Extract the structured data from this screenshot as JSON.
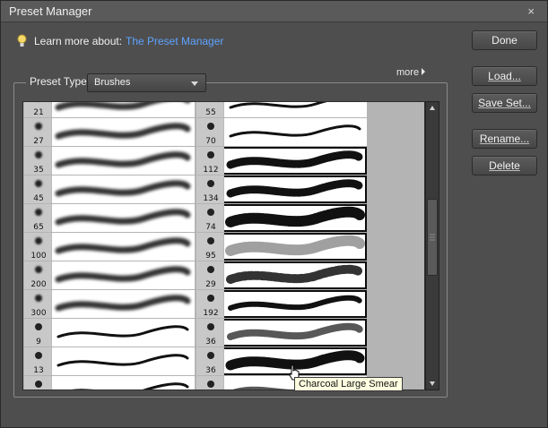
{
  "window": {
    "title": "Preset Manager",
    "close_glyph": "×"
  },
  "learn": {
    "label": "Learn more about:",
    "link": "The Preset Manager",
    "icon": "lightbulb-icon"
  },
  "buttons": {
    "done": "Done",
    "load": "Load...",
    "save_set": "Save Set...",
    "rename": "Rename...",
    "delete": "Delete"
  },
  "more": {
    "label": "more"
  },
  "preset_type": {
    "label": "Preset Type:",
    "value": "Brushes"
  },
  "brushes_left": [
    {
      "size": "21",
      "kind": "soft"
    },
    {
      "size": "27",
      "kind": "soft"
    },
    {
      "size": "35",
      "kind": "soft"
    },
    {
      "size": "45",
      "kind": "soft"
    },
    {
      "size": "65",
      "kind": "soft"
    },
    {
      "size": "100",
      "kind": "soft"
    },
    {
      "size": "200",
      "kind": "soft"
    },
    {
      "size": "300",
      "kind": "soft"
    },
    {
      "size": "9",
      "kind": "hard"
    },
    {
      "size": "13",
      "kind": "hard"
    },
    {
      "size": "",
      "kind": "hard"
    }
  ],
  "brushes_right": [
    {
      "size": "55",
      "kind": "hard"
    },
    {
      "size": "70",
      "kind": "hard"
    },
    {
      "size": "112",
      "kind": "grass"
    },
    {
      "size": "134",
      "kind": "grass"
    },
    {
      "size": "74",
      "kind": "leaf"
    },
    {
      "size": "95",
      "kind": "leaf-soft"
    },
    {
      "size": "29",
      "kind": "star"
    },
    {
      "size": "192",
      "kind": "chalk"
    },
    {
      "size": "36",
      "kind": "scatter"
    },
    {
      "size": "36",
      "kind": "smear"
    },
    {
      "size": "",
      "kind": "scatter"
    }
  ],
  "tooltip": "Charcoal Large Smear"
}
